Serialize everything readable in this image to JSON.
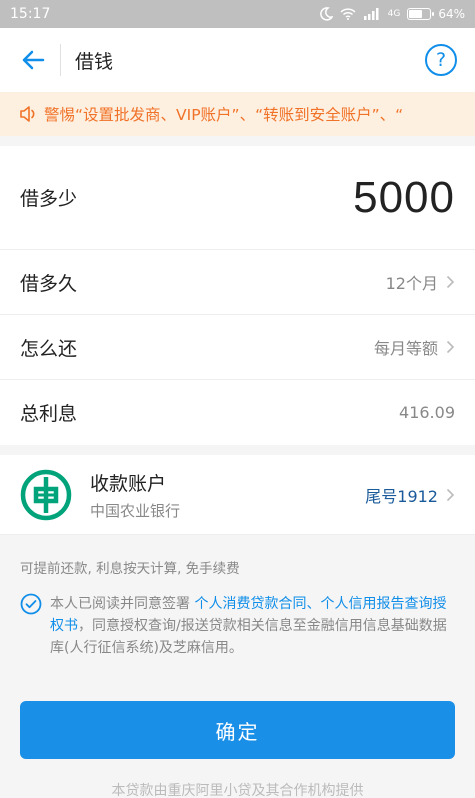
{
  "status": {
    "time": "15:17",
    "network": "4G",
    "battery": "64%",
    "battery_level": 0.64
  },
  "nav": {
    "title": "借钱",
    "help": "?"
  },
  "notice": {
    "text": "警惕“设置批发商、VIP账户”、“转账到安全账户”、“"
  },
  "loan": {
    "amount_label": "借多少",
    "amount": "5000",
    "rows": [
      {
        "label": "借多久",
        "value": "12个月"
      },
      {
        "label": "怎么还",
        "value": "每月等额"
      },
      {
        "label": "总利息",
        "value": "416.09"
      }
    ]
  },
  "account": {
    "title": "收款账户",
    "bank": "中国农业银行",
    "number": "尾号1912"
  },
  "info": {
    "line": "可提前还款, 利息按天计算, 免手续费",
    "agree_prefix": "本人已阅读并同意签署 ",
    "link1": "个人消费贷款合同",
    "sep": "、",
    "link2": "个人信用报告查询授权书",
    "agree_suffix": "，同意授权查询/报送贷款相关信息至金融信用信息基础数据库(人行征信系统)及芝麻信用。"
  },
  "confirm": "确定",
  "footer": "本贷款由重庆阿里小贷及其合作机构提供",
  "colors": {
    "accent": "#108ee9",
    "notice_bg": "#fef0e0",
    "notice_text": "#f07228",
    "account_num": "#1a5a9a"
  }
}
